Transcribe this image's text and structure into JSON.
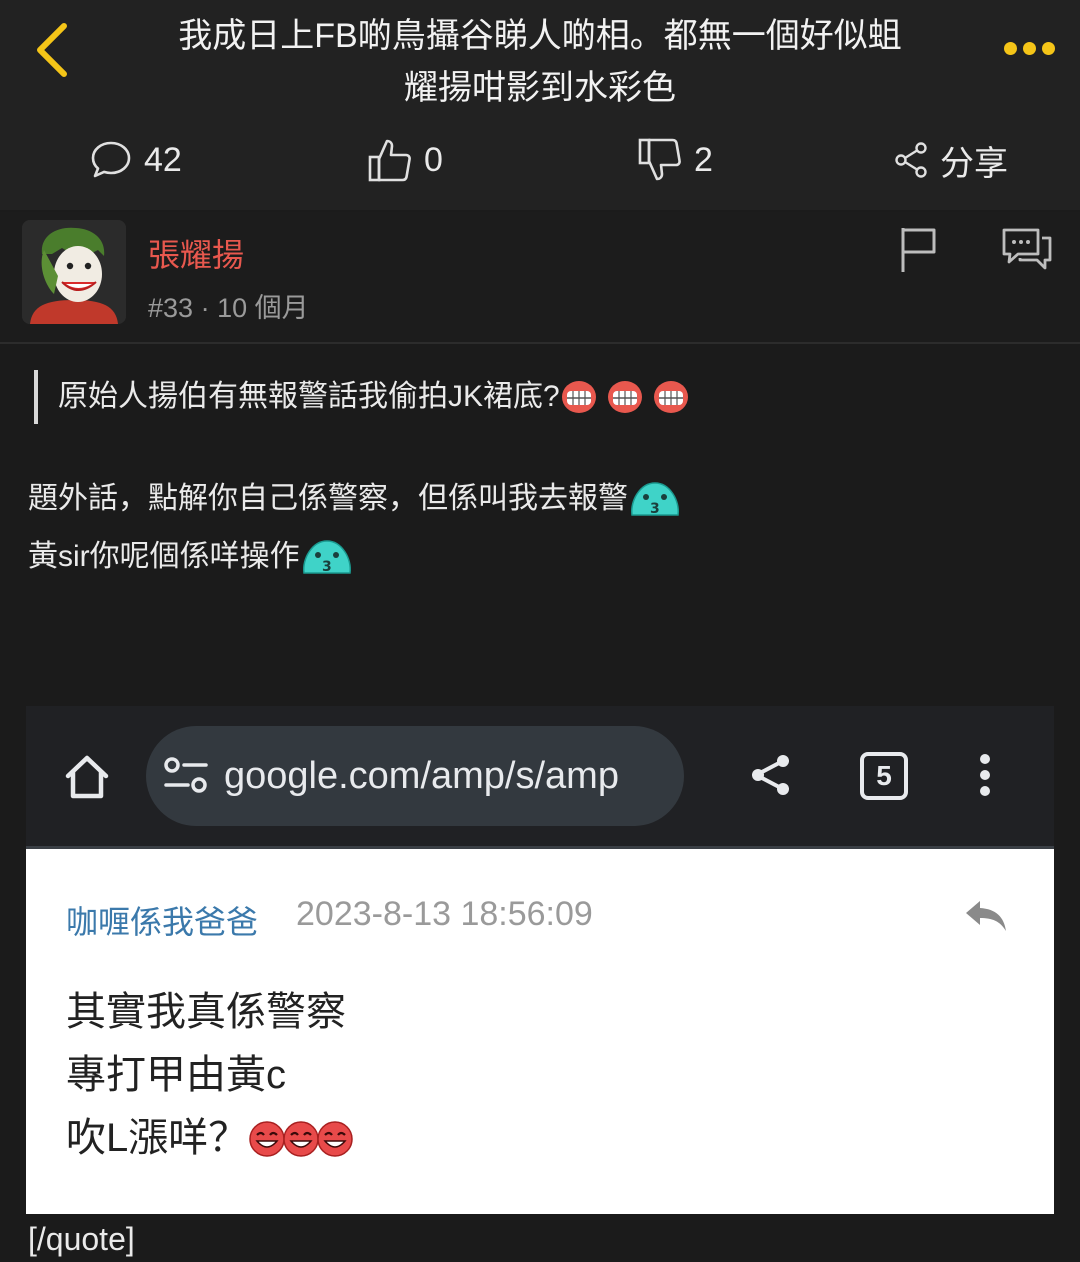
{
  "header": {
    "title_line1": "我成日上FB啲鳥攝谷睇人啲相。都無一個好似蛆",
    "title_line2": "耀揚咁影到水彩色",
    "accent_color": "#f5c518"
  },
  "stats": {
    "comments": "42",
    "likes": "0",
    "dislikes": "2",
    "share_label": "分享"
  },
  "post": {
    "username": "張耀揚",
    "username_color": "#e8584e",
    "floor": "#33",
    "age": "· 10 個月",
    "quote_text": "原始人揚伯有無報警話我偷拍JK裙底?",
    "body_line1": "題外話，點解你自己係警察，但係叫我去報警",
    "body_line2": "黃sir你呢個係咩操作",
    "closing_tag": "[/quote]"
  },
  "embedded": {
    "url": "google.com/amp/s/amp",
    "tab_count": "5",
    "comment_author": "咖喱係我爸爸",
    "comment_time": "2023-8-13 18:56:09",
    "comment_line1": "其實我真係警察",
    "comment_line2": "專打甲由黃c",
    "comment_line3": "吹L漲咩？"
  }
}
